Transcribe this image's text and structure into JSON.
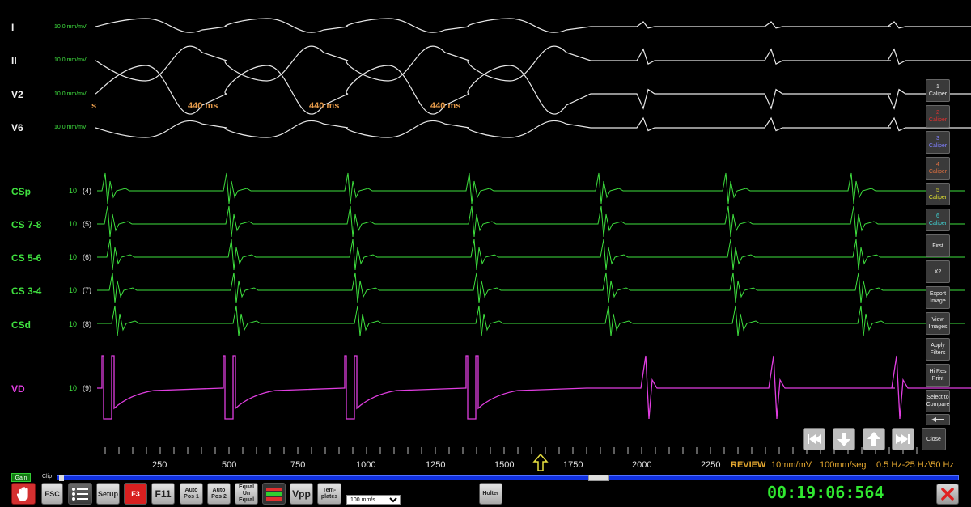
{
  "surface_leads": [
    {
      "label": "I",
      "gain": "10,0 mm/mV"
    },
    {
      "label": "II",
      "gain": "10,0 mm/mV"
    },
    {
      "label": "V2",
      "gain": "10,0 mm/mV"
    },
    {
      "label": "V6",
      "gain": "10,0 mm/mV"
    }
  ],
  "intracardiac": [
    {
      "label": "CSp",
      "gain": "10",
      "channel": "(4)"
    },
    {
      "label": "CS 7-8",
      "gain": "10",
      "channel": "(5)"
    },
    {
      "label": "CS 5-6",
      "gain": "10",
      "channel": "(6)"
    },
    {
      "label": "CS 3-4",
      "gain": "10",
      "channel": "(7)"
    },
    {
      "label": "CSd",
      "gain": "10",
      "channel": "(8)"
    },
    {
      "label": "VD",
      "gain": "10",
      "channel": "(9)"
    }
  ],
  "intervals": [
    "s",
    "440 ms",
    "440 ms",
    "440 ms"
  ],
  "side_buttons": [
    {
      "line1": "1",
      "line2": "Caliper",
      "color": "#eeeeee"
    },
    {
      "line1": "2",
      "line2": "Caliper",
      "color": "#e03030"
    },
    {
      "line1": "3",
      "line2": "Caliper",
      "color": "#8080ff"
    },
    {
      "line1": "4",
      "line2": "Caliper",
      "color": "#e07040"
    },
    {
      "line1": "5",
      "line2": "Caliper",
      "color": "#e0e030"
    },
    {
      "line1": "6",
      "line2": "Caliper",
      "color": "#40d0d0"
    },
    {
      "line1": "First",
      "line2": "",
      "color": "#eeeeee"
    },
    {
      "line1": "X2",
      "line2": "",
      "color": "#eeeeee"
    },
    {
      "line1": "Export",
      "line2": "Image",
      "color": "#eeeeee"
    },
    {
      "line1": "View",
      "line2": "Images",
      "color": "#eeeeee"
    },
    {
      "line1": "Apply",
      "line2": "Filters",
      "color": "#eeeeee"
    },
    {
      "line1": "Hi Res",
      "line2": "Print",
      "color": "#eeeeee"
    },
    {
      "line1": "Select to",
      "line2": "Compare",
      "color": "#eeeeee"
    }
  ],
  "nav": {
    "close": "Close"
  },
  "time_axis": [
    "250",
    "500",
    "750",
    "1000",
    "1250",
    "1500",
    "1750",
    "2000",
    "2250"
  ],
  "status": {
    "mode": "REVIEW",
    "gain": "10mm/mV",
    "speed": "100mm/seg",
    "filter": "0.5 Hz-25 Hz\\50 Hz"
  },
  "toolbar": {
    "gain": "Gain",
    "clip": "Clip",
    "esc": "ESC",
    "setup": "Setup",
    "f3": "F3",
    "f11": "F11",
    "autopos1_a": "Auto",
    "autopos1_b": "Pos 1",
    "autopos2_a": "Auto",
    "autopos2_b": "Pos 2",
    "equal_a": "Equal",
    "equal_b": "Un",
    "equal_c": "Equal",
    "vpp": "Vpp",
    "templates_a": "Tem-",
    "templates_b": "plates",
    "speed_select": "100 mm/s",
    "holter": "Holter"
  },
  "timer": "00:19:06:564",
  "colors": {
    "green": "#3fe03f",
    "magenta": "#e03ee0",
    "orange": "#e59a4a",
    "blue_bar": "#1030e0"
  }
}
